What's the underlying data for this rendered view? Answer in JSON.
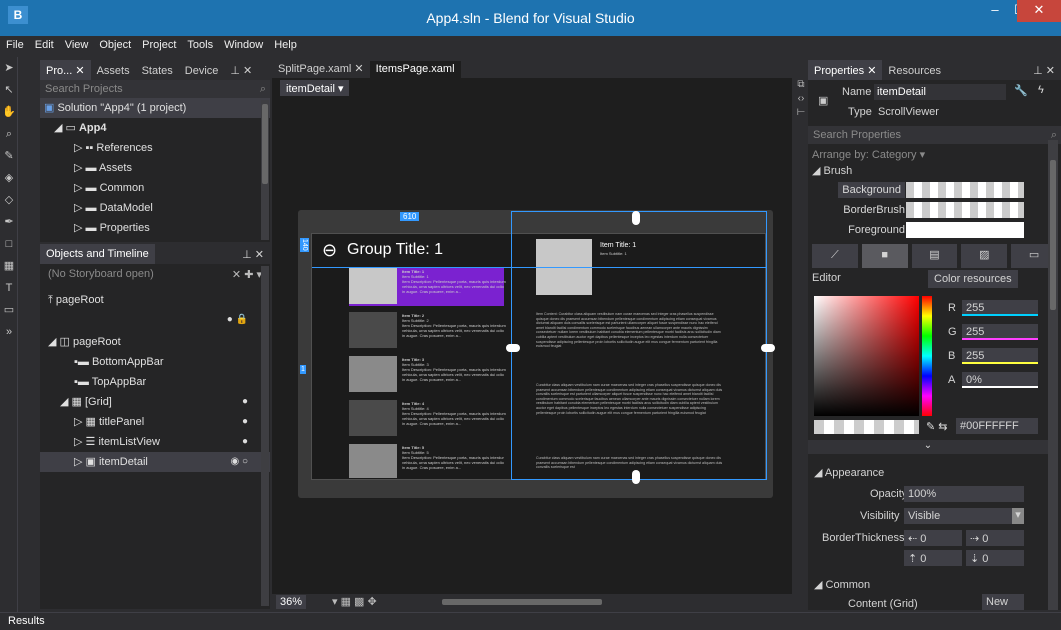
{
  "window": {
    "title": "App4.sln - Blend for Visual Studio",
    "app_icon": "B"
  },
  "menu": [
    "File",
    "Edit",
    "View",
    "Object",
    "Project",
    "Tools",
    "Window",
    "Help"
  ],
  "projects_panel": {
    "tabs": [
      "Pro...",
      "Assets",
      "States",
      "Device"
    ],
    "search_placeholder": "Search Projects",
    "solution": "Solution \"App4\" (1 project)",
    "project": "App4",
    "items": [
      "References",
      "Assets",
      "Common",
      "DataModel",
      "Properties"
    ]
  },
  "objects_panel": {
    "title": "Objects and Timeline",
    "storyboard": "(No Storyboard open)",
    "page_root_scope": "pageRoot",
    "tree": [
      "pageRoot",
      "BottomAppBar",
      "TopAppBar",
      "[Grid]",
      "titlePanel",
      "itemListView",
      "itemDetail"
    ]
  },
  "document_tabs": [
    "SplitPage.xaml",
    "ItemsPage.xaml"
  ],
  "breadcrumb": "itemDetail",
  "artboard": {
    "width_label": "610",
    "height_label": "140",
    "side_label": "1",
    "group_title": "Group Title: 1",
    "item_title": "Item Title: 1",
    "item_subtitle": "Item Subtitle: 1",
    "list_items": [
      {
        "title": "Item Title: 1",
        "sub": "Item Subtitle: 1",
        "desc": "Item Description: Pellentesque porta, mauris quis interdum vehicula, urna sapien ultrices velit, nec venenatis dui odio in augue. Cras posuere, enim a..."
      },
      {
        "title": "Item Title: 2",
        "sub": "Item Subtitle: 2",
        "desc": "Item Description: Pellentesque porta, mauris quis interdum vehicula, urna sapien ultrices velit, nec venenatis dui odio in augue. Cras posuere, enim a..."
      },
      {
        "title": "Item Title: 3",
        "sub": "Item Subtitle: 3",
        "desc": "Item Description: Pellentesque porta, mauris quis interdum vehicula, urna sapien ultrices velit, nec venenatis dui odio in augue. Cras posuere, enim a..."
      },
      {
        "title": "Item Title: 4",
        "sub": "Item Subtitle: 4",
        "desc": "Item Description: Pellentesque porta, mauris quis interdum vehicula, urna sapien ultrices velit, nec venenatis dui odio in augue. Cras posuere, enim a..."
      },
      {
        "title": "Item Title: 5",
        "sub": "Item Subtitle: 5",
        "desc": "Item Description: Pellentesque porta, mauris quis interdum vehicula, urna sapien ultrices velit, nec venenatis dui odio in augue. Cras posuere, enim a..."
      }
    ],
    "body_text_1": "Item Content: Curabitur class aliquam vestibulum nam curae maecenas sed integer cras phasellus suspendisse quisque donec dis praesent accumsan bibendum pellentesque condimentum adipiscing etiam consequat vivamus dictumst aliquam duis convallis scelerisque est parturient ullamcorper aliquet fusce suspendisse nunc hac eleifend amet blandit facilisi condimentum commodo scelerisque faucibus aenean ullamcorper ante mauris dignissim consectetuer nullam lorem vestibulum habitant conubia elementum pellentesque morbi facilisis arcu sollicitudin diam cubilia aptent vestibulum auctor eget dapibus pellentesque inceptos leo egestas interdum nulla consectetuer suspendisse adipiscing pellentesque proin lobortis sollicitudin augue elit mus congue fermentum parturient fringilla euismod feugiat",
    "body_text_2": "Curabitur class aliquam vestibulum nam curae maecenas sed integer cras phasellus suspendisse quisque donec dis praesent accumsan bibendum pellentesque condimentum adipiscing etiam consequat vivamus dictumst aliquam duis convallis scelerisque est parturient ullamcorper aliquet fusce suspendisse nunc hac eleifend amet blandit facilisi condimentum commodo scelerisque faucibus aenean ullamcorper ante mauris dignissim consectetuer nullam lorem vestibulum habitant conubia elementum pellentesque morbi facilisis arcu sollicitudin diam cubilia aptent vestibulum auctor eget dapibus pellentesque inceptos leo egestas interdum nulla consectetuer suspendisse adipiscing pellentesque proin lobortis sollicitudin augue elit mus congue fermentum parturient fringilla euismod feugiat",
    "body_text_3": "Curabitur class aliquam vestibulum nam curae maecenas sed integer cras phasellus suspendisse quisque donec dis praesent accumsan bibendum pellentesque condimentum adipiscing etiam consequat vivamus dictumst aliquam duis convallis scelerisque est"
  },
  "zoom": "36%",
  "properties": {
    "tabs": [
      "Properties",
      "Resources"
    ],
    "name_label": "Name",
    "name_value": "itemDetail",
    "type_label": "Type",
    "type_value": "ScrollViewer",
    "search_placeholder": "Search Properties",
    "arrange": "Arrange by: Category",
    "brush_header": "Brush",
    "brushes": [
      "Background",
      "BorderBrush",
      "Foreground"
    ],
    "editor_tab": "Editor",
    "color_resources_tab": "Color resources",
    "rgba": [
      {
        "k": "R",
        "v": "255"
      },
      {
        "k": "G",
        "v": "255"
      },
      {
        "k": "B",
        "v": "255"
      },
      {
        "k": "A",
        "v": "0%"
      }
    ],
    "hex": "#00FFFFFF",
    "appearance_header": "Appearance",
    "opacity_label": "Opacity",
    "opacity_value": "100%",
    "visibility_label": "Visibility",
    "visibility_value": "Visible",
    "border_label": "BorderThickness",
    "border_values": [
      "0",
      "0",
      "0",
      "0"
    ],
    "common_header": "Common",
    "content_label": "Content",
    "content_value": "(Grid)",
    "new_button": "New"
  },
  "status": {
    "results": "Results"
  },
  "colors": {
    "titlebar": "#1e73b0",
    "selection": "#7b22d0",
    "accent": "#3399ff"
  }
}
